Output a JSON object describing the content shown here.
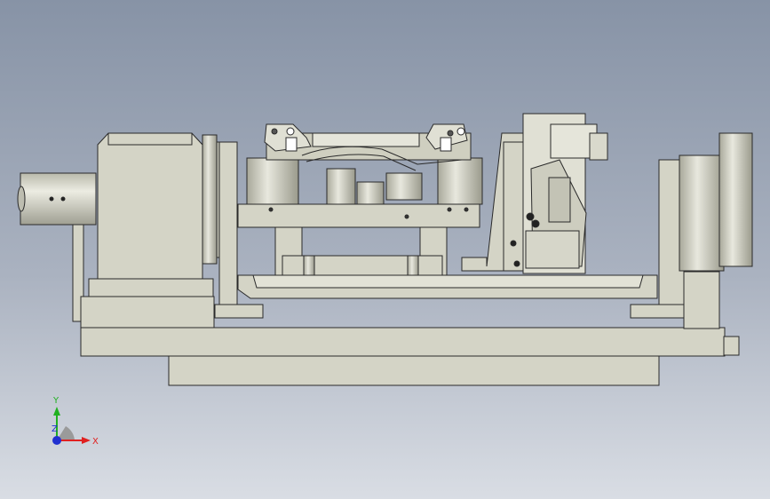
{
  "viewport": {
    "background_top": "#8793a6",
    "background_bottom": "#d9dde4",
    "model_fill": "#d4d4c6",
    "model_edge": "#2a2a2a"
  },
  "triad": {
    "x_label": "X",
    "y_label": "Y",
    "z_label": "Z",
    "x_color": "#e02020",
    "y_color": "#20b020",
    "z_color": "#2030d0"
  }
}
